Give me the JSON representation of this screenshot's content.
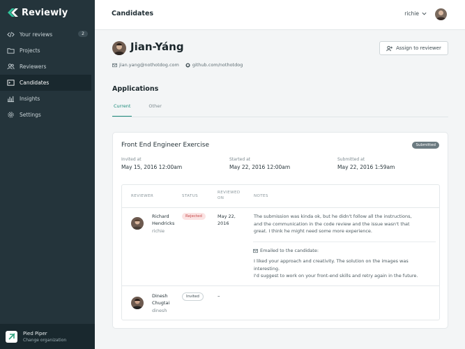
{
  "brand": {
    "name": "Reviewly",
    "accent": "#1b8a7a"
  },
  "sidebar": {
    "items": [
      {
        "label": "Your reviews",
        "icon": "code-icon",
        "badge": "2",
        "active": false
      },
      {
        "label": "Projects",
        "icon": "folder-icon",
        "active": false
      },
      {
        "label": "Reviewers",
        "icon": "users-icon",
        "active": false
      },
      {
        "label": "Candidates",
        "icon": "terminal-icon",
        "active": true
      },
      {
        "label": "Insights",
        "icon": "bar-chart-icon",
        "active": false
      },
      {
        "label": "Settings",
        "icon": "gear-icon",
        "active": false
      }
    ],
    "org": {
      "name": "Pied Piper",
      "action": "Change organization"
    }
  },
  "header": {
    "title": "Candidates",
    "user": "richie"
  },
  "candidate": {
    "name": "Jian-Yáng",
    "email": "jian.yang@nothotdog.com",
    "github": "github.com/nothotdog",
    "assign_label": "Assign to reviewer"
  },
  "applications": {
    "title": "Applications",
    "tabs": [
      {
        "label": "Current",
        "active": true
      },
      {
        "label": "Other",
        "active": false
      }
    ]
  },
  "exercise": {
    "title": "Front End Engineer Exercise",
    "status": "Submitted",
    "invited_label": "Invited at",
    "invited_value": "May 15, 2016 12:00am",
    "started_label": "Started at",
    "started_value": "May 22, 2016 12:00am",
    "submitted_label": "Submitted at",
    "submitted_value": "May 22, 2016 1:59am",
    "columns": {
      "reviewer": "REVIEWER",
      "status": "STATUS",
      "reviewed_on_1": "REVIEWED",
      "reviewed_on_2": "ON",
      "notes": "NOTES"
    },
    "reviews": [
      {
        "name_line1": "Richard",
        "name_line2": "Hendricks",
        "handle": "richie",
        "status": "Rejected",
        "date_line1": "May 22,",
        "date_line2": "2016",
        "note_lines": [
          "The submission was kinda ok, but he didn't follow all the instructions,",
          "and the communication in the code review and the issue wasn't that",
          "great. I think he might need some more experience."
        ],
        "emailed_label": "Emailed to the candidate:",
        "email_lines": [
          "I liked your approach and creativity. The solution on the images was",
          "interesting.",
          "I'd suggest to work on your front-end skills and retry again in the future."
        ]
      },
      {
        "name_line1": "Dinesh",
        "name_line2": "Chugtai",
        "handle": "dinesh",
        "status": "Invited",
        "date": "–"
      }
    ]
  }
}
